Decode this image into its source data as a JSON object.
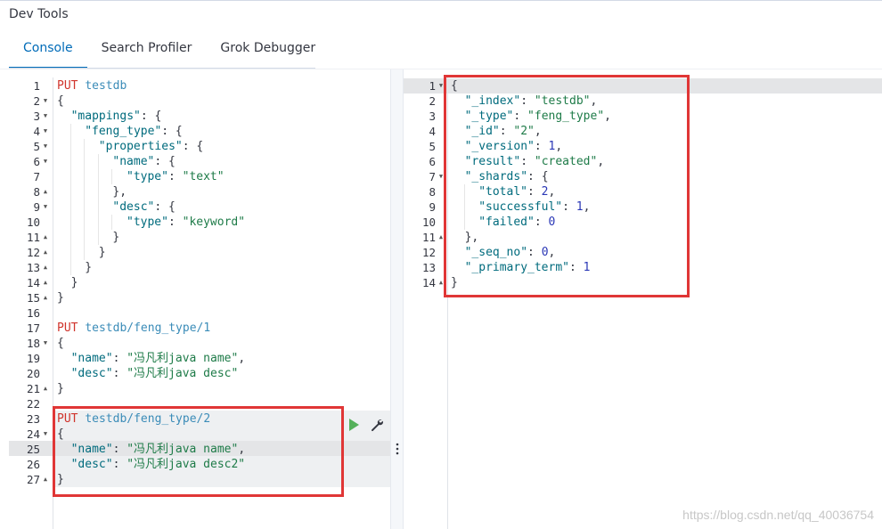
{
  "app": {
    "title": "Dev Tools"
  },
  "tabs": [
    {
      "label": "Console",
      "active": true
    },
    {
      "label": "Search Profiler",
      "active": false
    },
    {
      "label": "Grok Debugger",
      "active": false
    }
  ],
  "request_editor": {
    "lines": [
      {
        "n": "1",
        "fold": "",
        "indent": 0,
        "tokens": [
          [
            "method",
            "PUT"
          ],
          [
            "punct",
            " "
          ],
          [
            "url",
            "testdb"
          ]
        ]
      },
      {
        "n": "2",
        "fold": "open",
        "indent": 0,
        "tokens": [
          [
            "punct",
            "{"
          ]
        ]
      },
      {
        "n": "3",
        "fold": "open",
        "indent": 1,
        "tokens": [
          [
            "key",
            "\"mappings\""
          ],
          [
            "punct",
            ": {"
          ]
        ]
      },
      {
        "n": "4",
        "fold": "open",
        "indent": 2,
        "tokens": [
          [
            "key",
            "\"feng_type\""
          ],
          [
            "punct",
            ": {"
          ]
        ]
      },
      {
        "n": "5",
        "fold": "open",
        "indent": 3,
        "tokens": [
          [
            "key",
            "\"properties\""
          ],
          [
            "punct",
            ": {"
          ]
        ]
      },
      {
        "n": "6",
        "fold": "open",
        "indent": 4,
        "tokens": [
          [
            "key",
            "\"name\""
          ],
          [
            "punct",
            ": {"
          ]
        ]
      },
      {
        "n": "7",
        "fold": "",
        "indent": 5,
        "tokens": [
          [
            "key",
            "\"type\""
          ],
          [
            "punct",
            ": "
          ],
          [
            "str",
            "\"text\""
          ]
        ]
      },
      {
        "n": "8",
        "fold": "close",
        "indent": 4,
        "tokens": [
          [
            "punct",
            "},"
          ]
        ]
      },
      {
        "n": "9",
        "fold": "open",
        "indent": 4,
        "tokens": [
          [
            "key",
            "\"desc\""
          ],
          [
            "punct",
            ": {"
          ]
        ]
      },
      {
        "n": "10",
        "fold": "",
        "indent": 5,
        "tokens": [
          [
            "key",
            "\"type\""
          ],
          [
            "punct",
            ": "
          ],
          [
            "str",
            "\"keyword\""
          ]
        ]
      },
      {
        "n": "11",
        "fold": "close",
        "indent": 4,
        "tokens": [
          [
            "punct",
            "}"
          ]
        ]
      },
      {
        "n": "12",
        "fold": "close",
        "indent": 3,
        "tokens": [
          [
            "punct",
            "}"
          ]
        ]
      },
      {
        "n": "13",
        "fold": "close",
        "indent": 2,
        "tokens": [
          [
            "punct",
            "}"
          ]
        ]
      },
      {
        "n": "14",
        "fold": "close",
        "indent": 1,
        "tokens": [
          [
            "punct",
            "}"
          ]
        ]
      },
      {
        "n": "15",
        "fold": "close",
        "indent": 0,
        "tokens": [
          [
            "punct",
            "}"
          ]
        ]
      },
      {
        "n": "16",
        "fold": "",
        "indent": 0,
        "tokens": []
      },
      {
        "n": "17",
        "fold": "",
        "indent": 0,
        "tokens": [
          [
            "method",
            "PUT"
          ],
          [
            "punct",
            " "
          ],
          [
            "url",
            "testdb/feng_type/1"
          ]
        ]
      },
      {
        "n": "18",
        "fold": "open",
        "indent": 0,
        "tokens": [
          [
            "punct",
            "{"
          ]
        ]
      },
      {
        "n": "19",
        "fold": "",
        "indent": 1,
        "tokens": [
          [
            "key",
            "\"name\""
          ],
          [
            "punct",
            ": "
          ],
          [
            "str",
            "\"冯凡利java name\""
          ],
          [
            "punct",
            ","
          ]
        ]
      },
      {
        "n": "20",
        "fold": "",
        "indent": 1,
        "tokens": [
          [
            "key",
            "\"desc\""
          ],
          [
            "punct",
            ": "
          ],
          [
            "str",
            "\"冯凡利java desc\""
          ]
        ]
      },
      {
        "n": "21",
        "fold": "close",
        "indent": 0,
        "tokens": [
          [
            "punct",
            "}"
          ]
        ]
      },
      {
        "n": "22",
        "fold": "",
        "indent": 0,
        "tokens": []
      },
      {
        "n": "23",
        "fold": "",
        "indent": 0,
        "tokens": [
          [
            "method",
            "PUT"
          ],
          [
            "punct",
            " "
          ],
          [
            "url",
            "testdb/feng_type/2"
          ]
        ]
      },
      {
        "n": "24",
        "fold": "open",
        "indent": 0,
        "tokens": [
          [
            "punct",
            "{"
          ]
        ]
      },
      {
        "n": "25",
        "fold": "",
        "indent": 1,
        "tokens": [
          [
            "key",
            "\"name\""
          ],
          [
            "punct",
            ": "
          ],
          [
            "str",
            "\"冯凡利java name\""
          ],
          [
            "punct",
            ","
          ]
        ]
      },
      {
        "n": "26",
        "fold": "",
        "indent": 1,
        "tokens": [
          [
            "key",
            "\"desc\""
          ],
          [
            "punct",
            ": "
          ],
          [
            "str",
            "\"冯凡利java desc2\""
          ]
        ]
      },
      {
        "n": "27",
        "fold": "close",
        "indent": 0,
        "tokens": [
          [
            "punct",
            "}"
          ]
        ]
      }
    ],
    "active_line": "25",
    "selected_request_lines": [
      "23",
      "27"
    ],
    "run_icon": "play-icon",
    "settings_icon": "wrench-icon",
    "more_icon": "kebab-icon"
  },
  "response_viewer": {
    "lines": [
      {
        "n": "1",
        "fold": "open",
        "indent": 0,
        "tokens": [
          [
            "punct",
            "{"
          ]
        ]
      },
      {
        "n": "2",
        "fold": "",
        "indent": 1,
        "tokens": [
          [
            "key",
            "\"_index\""
          ],
          [
            "punct",
            ": "
          ],
          [
            "str",
            "\"testdb\""
          ],
          [
            "punct",
            ","
          ]
        ]
      },
      {
        "n": "3",
        "fold": "",
        "indent": 1,
        "tokens": [
          [
            "key",
            "\"_type\""
          ],
          [
            "punct",
            ": "
          ],
          [
            "str",
            "\"feng_type\""
          ],
          [
            "punct",
            ","
          ]
        ]
      },
      {
        "n": "4",
        "fold": "",
        "indent": 1,
        "tokens": [
          [
            "key",
            "\"_id\""
          ],
          [
            "punct",
            ": "
          ],
          [
            "str",
            "\"2\""
          ],
          [
            "punct",
            ","
          ]
        ]
      },
      {
        "n": "5",
        "fold": "",
        "indent": 1,
        "tokens": [
          [
            "key",
            "\"_version\""
          ],
          [
            "punct",
            ": "
          ],
          [
            "num",
            "1"
          ],
          [
            "punct",
            ","
          ]
        ]
      },
      {
        "n": "6",
        "fold": "",
        "indent": 1,
        "tokens": [
          [
            "key",
            "\"result\""
          ],
          [
            "punct",
            ": "
          ],
          [
            "str",
            "\"created\""
          ],
          [
            "punct",
            ","
          ]
        ]
      },
      {
        "n": "7",
        "fold": "open",
        "indent": 1,
        "tokens": [
          [
            "key",
            "\"_shards\""
          ],
          [
            "punct",
            ": {"
          ]
        ]
      },
      {
        "n": "8",
        "fold": "",
        "indent": 2,
        "tokens": [
          [
            "key",
            "\"total\""
          ],
          [
            "punct",
            ": "
          ],
          [
            "num",
            "2"
          ],
          [
            "punct",
            ","
          ]
        ]
      },
      {
        "n": "9",
        "fold": "",
        "indent": 2,
        "tokens": [
          [
            "key",
            "\"successful\""
          ],
          [
            "punct",
            ": "
          ],
          [
            "num",
            "1"
          ],
          [
            "punct",
            ","
          ]
        ]
      },
      {
        "n": "10",
        "fold": "",
        "indent": 2,
        "tokens": [
          [
            "key",
            "\"failed\""
          ],
          [
            "punct",
            ": "
          ],
          [
            "num",
            "0"
          ]
        ]
      },
      {
        "n": "11",
        "fold": "close",
        "indent": 1,
        "tokens": [
          [
            "punct",
            "},"
          ]
        ]
      },
      {
        "n": "12",
        "fold": "",
        "indent": 1,
        "tokens": [
          [
            "key",
            "\"_seq_no\""
          ],
          [
            "punct",
            ": "
          ],
          [
            "num",
            "0"
          ],
          [
            "punct",
            ","
          ]
        ]
      },
      {
        "n": "13",
        "fold": "",
        "indent": 1,
        "tokens": [
          [
            "key",
            "\"_primary_term\""
          ],
          [
            "punct",
            ": "
          ],
          [
            "num",
            "1"
          ]
        ]
      },
      {
        "n": "14",
        "fold": "close",
        "indent": 0,
        "tokens": [
          [
            "punct",
            "}"
          ]
        ]
      }
    ],
    "active_line": "1"
  },
  "colors": {
    "method": "#d0342c",
    "url": "#3b8cb8",
    "accent": "#006bb8",
    "annotation_box": "#e03636"
  },
  "watermark": "https://blog.csdn.net/qq_40036754"
}
